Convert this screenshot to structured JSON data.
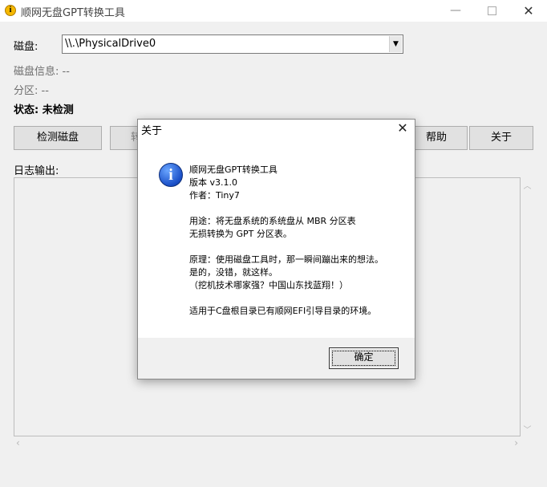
{
  "window": {
    "title": "顺网无盘GPT转换工具",
    "controls": {
      "minimize": "—",
      "close": "✕"
    }
  },
  "form": {
    "disk_label": "磁盘:",
    "disk_value": "\\\\.\\PhysicalDrive0",
    "disk_info": "磁盘信息: --",
    "partition": "分区: --",
    "status": "状态: 未检测",
    "buttons": {
      "detect": "检测磁盘",
      "convert": "转",
      "help": "帮助",
      "about": "关于"
    },
    "log_label": "日志输出:"
  },
  "dialog": {
    "title": "关于",
    "lines": [
      "顺网无盘GPT转换工具",
      "版本 v3.1.0",
      "作者：Tiny7",
      "用途：将无盘系统的系统盘从 MBR 分区表",
      "无损转换为 GPT 分区表。",
      "原理：使用磁盘工具时，那一瞬间蹦出来的想法。",
      "是的，没错，就这样。",
      "（挖机技术哪家强？中国山东找蓝翔！）",
      "适用于C盘根目录已有顺网EFI引导目录的环境。"
    ],
    "ok_label": "确定"
  },
  "icons": {
    "app": "warning-info-icon",
    "dialog": "info-icon"
  },
  "colors": {
    "window_bg": "#f0f0f0",
    "dialog_icon": "#1a4fc7",
    "app_icon": "#f5b800"
  }
}
